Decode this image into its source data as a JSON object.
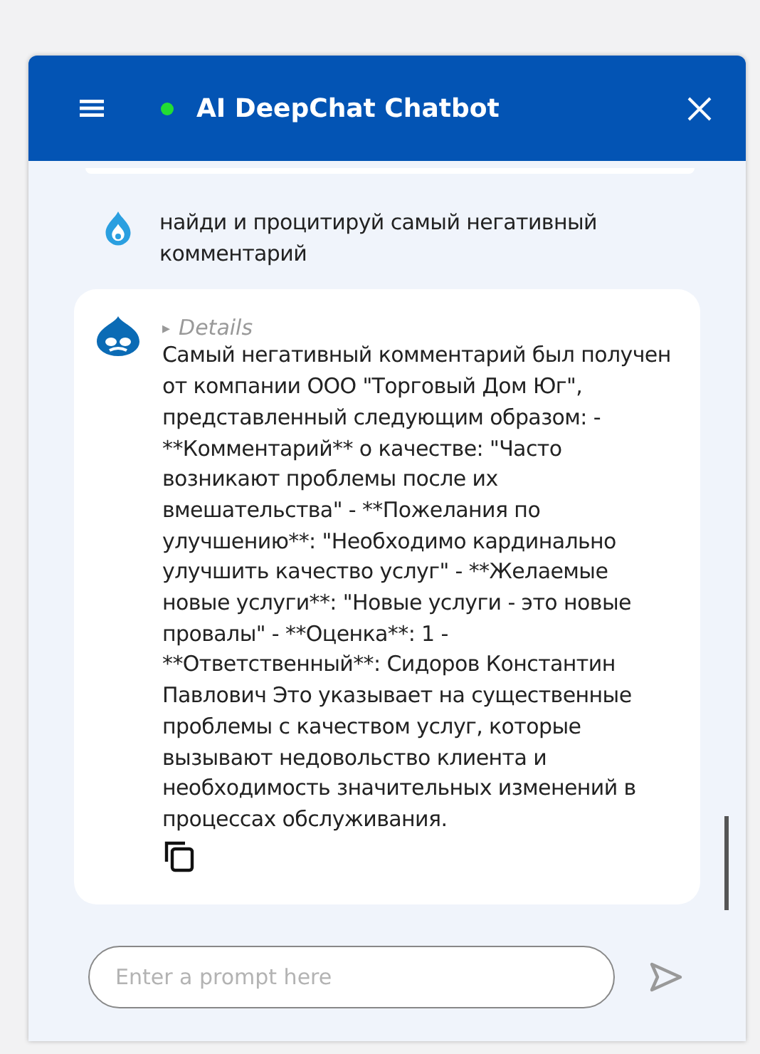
{
  "header": {
    "title": "AI DeepChat Chatbot"
  },
  "messages": [
    {
      "kind": "user",
      "text": "найди и процитируй самый негативный комментарий"
    },
    {
      "kind": "bot",
      "details": {
        "marker": "▸",
        "label": "Details",
        "expanded": false
      },
      "text": "Самый негативный комментарий был получен от компании ООО \"Торговый Дом Юг\", представленный следующим образом: - **Комментарий** о качестве: \"Часто возникают проблемы после их вмешательства\" - **Пожелания по улучшению**: \"Необходимо кардинально улучшить качество услуг\" - **Желаемые новые услуги**: \"Новые услуги - это новые провалы\" - **Оценка**: 1 - **Ответственный**: Сидоров Константин Павлович Это указывает на существенные проблемы с качеством услуг, которые вызывают недовольство клиента и необходимость значительных изменений в процессах обслуживания."
    }
  ],
  "composer": {
    "placeholder": "Enter a prompt here"
  }
}
